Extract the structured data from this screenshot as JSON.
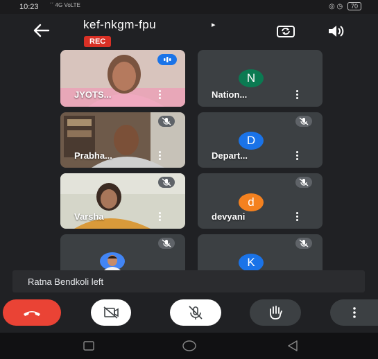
{
  "status_bar": {
    "time": "10:23",
    "signal": "´´ 4G VoLTE",
    "right_icons": "◎ ◷",
    "battery": "70"
  },
  "header": {
    "meeting_code": "kef-nkgm-fpu",
    "caret": "▸",
    "recording_badge": "REC"
  },
  "participants": [
    {
      "name": "JYOTS...",
      "type": "video",
      "speaking": true
    },
    {
      "name": "Nation...",
      "type": "avatar",
      "initial": "N",
      "avatar_color": "#0b7a52"
    },
    {
      "name": "Prabha...",
      "type": "video",
      "muted": true
    },
    {
      "name": "Depart...",
      "type": "avatar",
      "initial": "D",
      "avatar_color": "#1a73e8",
      "muted": true
    },
    {
      "name": "Varsha",
      "type": "video",
      "muted": true
    },
    {
      "name": "devyani",
      "type": "avatar",
      "initial": "d",
      "avatar_color": "#f4811f",
      "muted": true
    },
    {
      "name": "",
      "type": "photo",
      "muted": true
    },
    {
      "name": "",
      "type": "avatar",
      "initial": "K",
      "avatar_color": "#1a73e8",
      "muted": true
    }
  ],
  "notification": {
    "text": "Ratna Bendkoli left"
  },
  "controls": {
    "end_call_color": "#ea4335",
    "toggle_color": "#ffffff",
    "secondary_color": "#3c4043"
  },
  "colors": {
    "background": "#202124",
    "tile": "#3c4043",
    "speaking_badge": "#1a73e8",
    "rec": "#d93025"
  }
}
